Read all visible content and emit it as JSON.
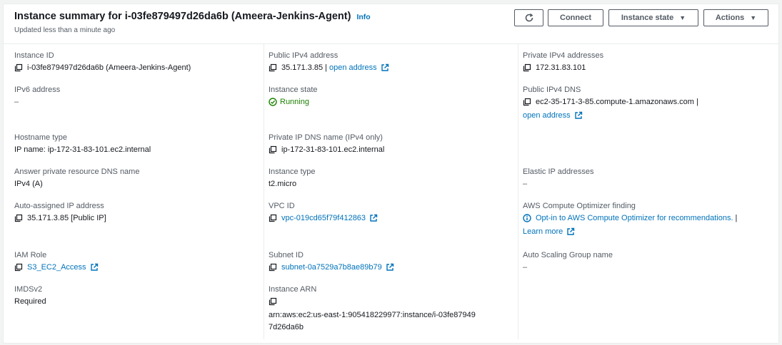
{
  "header": {
    "title": "Instance summary for i-03fe879497d26da6b (Ameera-Jenkins-Agent)",
    "info": "Info",
    "updated": "Updated less than a minute ago",
    "buttons": {
      "connect": "Connect",
      "instance_state": "Instance state",
      "actions": "Actions"
    }
  },
  "col1": {
    "instance_id": {
      "label": "Instance ID",
      "value": "i-03fe879497d26da6b (Ameera-Jenkins-Agent)"
    },
    "ipv6": {
      "label": "IPv6 address",
      "value": "–"
    },
    "hostname_type": {
      "label": "Hostname type",
      "value": "IP name: ip-172-31-83-101.ec2.internal"
    },
    "answer_dns": {
      "label": "Answer private resource DNS name",
      "value": "IPv4 (A)"
    },
    "auto_ip": {
      "label": "Auto-assigned IP address",
      "value": "35.171.3.85 [Public IP]"
    },
    "iam_role": {
      "label": "IAM Role",
      "value": "S3_EC2_Access"
    },
    "imdsv2": {
      "label": "IMDSv2",
      "value": "Required"
    }
  },
  "col2": {
    "public_ipv4": {
      "label": "Public IPv4 address",
      "value": "35.171.3.85",
      "sep": "|",
      "link": "open address"
    },
    "instance_state": {
      "label": "Instance state",
      "value": "Running"
    },
    "private_dns": {
      "label": "Private IP DNS name (IPv4 only)",
      "value": "ip-172-31-83-101.ec2.internal"
    },
    "instance_type": {
      "label": "Instance type",
      "value": "t2.micro"
    },
    "vpc": {
      "label": "VPC ID",
      "value": "vpc-019cd65f79f412863"
    },
    "subnet": {
      "label": "Subnet ID",
      "value": "subnet-0a7529a7b8ae89b79"
    },
    "arn": {
      "label": "Instance ARN",
      "value": "arn:aws:ec2:us-east-1:905418229977:instance/i-03fe879497d26da6b"
    }
  },
  "col3": {
    "private_ipv4": {
      "label": "Private IPv4 addresses",
      "value": "172.31.83.101"
    },
    "public_dns": {
      "label": "Public IPv4 DNS",
      "value": "ec2-35-171-3-85.compute-1.amazonaws.com",
      "sep": "|",
      "link": "open address"
    },
    "elastic_ip": {
      "label": "Elastic IP addresses",
      "value": "–"
    },
    "optimizer": {
      "label": "AWS Compute Optimizer finding",
      "value": "Opt-in to AWS Compute Optimizer for recommendations.",
      "sep": "|",
      "link": "Learn more"
    },
    "asg": {
      "label": "Auto Scaling Group name",
      "value": "–"
    }
  },
  "colors": {
    "link": "#0073bb",
    "running": "#1d8102",
    "label": "#545b64",
    "text": "#16191f"
  }
}
